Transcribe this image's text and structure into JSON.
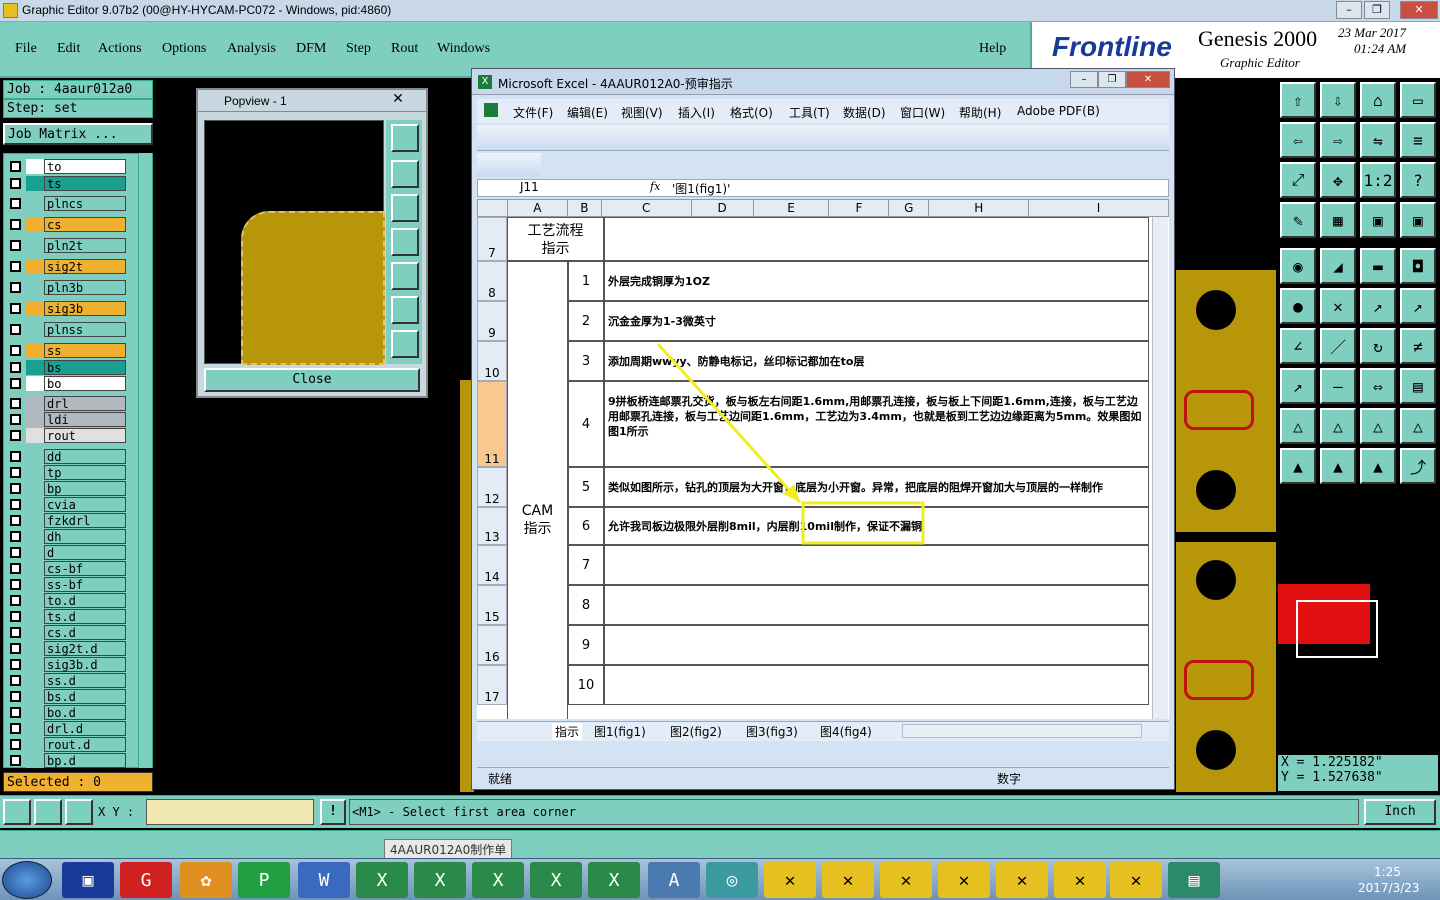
{
  "window": {
    "title": "Graphic Editor 9.07b2 (00@HY-HYCAM-PC072 - Windows, pid:4860)"
  },
  "menu": [
    "File",
    "Edit",
    "Actions",
    "Options",
    "Analysis",
    "DFM",
    "Step",
    "Rout",
    "Windows"
  ],
  "help": "Help",
  "brand": {
    "logo": "Frontline",
    "product": "Genesis 2000",
    "sub": "Graphic Editor",
    "date": "23 Mar 2017",
    "time": "01:24 AM"
  },
  "job": {
    "job": "Job : 4aaur012a0",
    "step": "Step: set",
    "matrix": "Job Matrix ..."
  },
  "layers": [
    {
      "n": "to",
      "c": "#ffffff"
    },
    {
      "n": "ts",
      "c": "#1aa090"
    },
    {
      "n": "plncs",
      "c": "#7ecfc0"
    },
    {
      "n": "cs",
      "c": "#f0b030"
    },
    {
      "n": "pln2t",
      "c": "#7ecfc0"
    },
    {
      "n": "sig2t",
      "c": "#f0b030"
    },
    {
      "n": "pln3b",
      "c": "#7ecfc0"
    },
    {
      "n": "sig3b",
      "c": "#f0b030"
    },
    {
      "n": "plnss",
      "c": "#7ecfc0"
    },
    {
      "n": "ss",
      "c": "#f0b030"
    },
    {
      "n": "bs",
      "c": "#1aa090"
    },
    {
      "n": "bo",
      "c": "#ffffff"
    },
    {
      "n": "drl",
      "c": "#b0b8c0"
    },
    {
      "n": "ldi",
      "c": "#b0b8c0"
    },
    {
      "n": "rout",
      "c": "#e0e0e0"
    },
    {
      "n": "dd",
      "c": "#7ecfc0"
    },
    {
      "n": "tp",
      "c": "#7ecfc0"
    },
    {
      "n": "bp",
      "c": "#7ecfc0"
    },
    {
      "n": "cvia",
      "c": "#7ecfc0"
    },
    {
      "n": "fzkdrl",
      "c": "#7ecfc0"
    },
    {
      "n": "dh",
      "c": "#7ecfc0"
    },
    {
      "n": "d",
      "c": "#7ecfc0"
    },
    {
      "n": "cs-bf",
      "c": "#7ecfc0"
    },
    {
      "n": "ss-bf",
      "c": "#7ecfc0"
    },
    {
      "n": "to.d",
      "c": "#7ecfc0"
    },
    {
      "n": "ts.d",
      "c": "#7ecfc0"
    },
    {
      "n": "cs.d",
      "c": "#7ecfc0"
    },
    {
      "n": "sig2t.d",
      "c": "#7ecfc0"
    },
    {
      "n": "sig3b.d",
      "c": "#7ecfc0"
    },
    {
      "n": "ss.d",
      "c": "#7ecfc0"
    },
    {
      "n": "bs.d",
      "c": "#7ecfc0"
    },
    {
      "n": "bo.d",
      "c": "#7ecfc0"
    },
    {
      "n": "drl.d",
      "c": "#7ecfc0"
    },
    {
      "n": "rout.d",
      "c": "#7ecfc0"
    },
    {
      "n": "bp.d",
      "c": "#7ecfc0"
    }
  ],
  "selected": "Selected : 0",
  "popview": {
    "title": "Popview - 1",
    "close": "Close"
  },
  "excel": {
    "title": "Microsoft Excel - 4AAUR012A0-预审指示",
    "menu": [
      "文件(F)",
      "编辑(E)",
      "视图(V)",
      "插入(I)",
      "格式(O)",
      "工具(T)",
      "数据(D)",
      "窗口(W)",
      "帮助(H)",
      "Adobe PDF(B)"
    ],
    "cellref": "J11",
    "fx": "fx",
    "formula": "'图1(fig1)'",
    "cols": [
      "A",
      "B",
      "C",
      "D",
      "E",
      "F",
      "G",
      "H",
      "I"
    ],
    "rows": [
      {
        "r": "7",
        "b": "",
        "c": ""
      },
      {
        "r": "8",
        "b": "1",
        "c": "外层完成铜厚为1OZ"
      },
      {
        "r": "9",
        "b": "2",
        "c": "沉金金厚为1-3微英寸"
      },
      {
        "r": "10",
        "b": "3",
        "c": "添加周期wwyy、防静电标记，丝印标记都加在to层"
      },
      {
        "r": "11",
        "b": "4",
        "c": "9拼板桥连邮票孔交货，板与板左右间距1.6mm,用邮票孔连接，板与板上下间距1.6mm,连接，板与工艺边用邮票孔连接，板与工艺边间距1.6mm，工艺边为3.4mm，也就是板到工艺边边缘距离为5mm。效果图如图1所示"
      },
      {
        "r": "12",
        "b": "5",
        "c": "类似如图所示，钻孔的顶层为大开窗，底层为小开窗。异常，把底层的阻焊开窗加大与顶层的一样制作"
      },
      {
        "r": "13",
        "b": "6",
        "c": "允许我司板边极限外层削8mil，内层削10mil制作，保证不漏铜"
      },
      {
        "r": "14",
        "b": "7",
        "c": ""
      },
      {
        "r": "15",
        "b": "8",
        "c": ""
      },
      {
        "r": "16",
        "b": "9",
        "c": ""
      },
      {
        "r": "17",
        "b": "10",
        "c": ""
      }
    ],
    "a7": "工艺流程指示",
    "acam": "CAM指示",
    "sheets": [
      "指示",
      "图1(fig1)",
      "图2(fig2)",
      "图3(fig3)",
      "图4(fig4)"
    ],
    "status": "就绪",
    "status2": "数字"
  },
  "coords": {
    "x": "X = 1.225182\"",
    "y": "Y = 1.527638\""
  },
  "statusbar": {
    "xy": "X Y :",
    "prompt": "<M1> - Select first area corner",
    "unit": "Inch"
  },
  "tooltip": "4AAUR012A0制作单",
  "tray": {
    "time": "1:25",
    "date": "2017/3/23"
  }
}
